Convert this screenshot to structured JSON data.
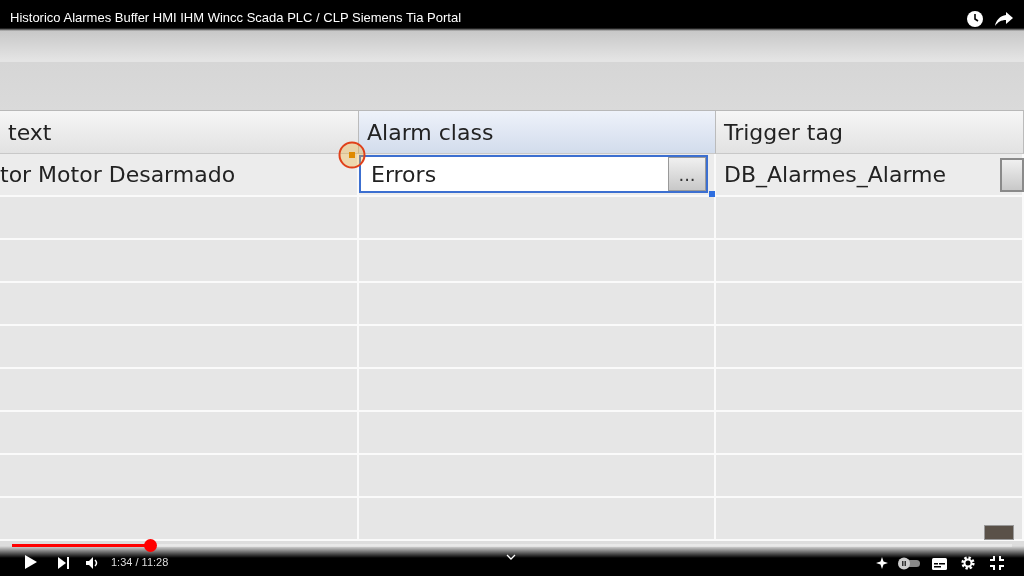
{
  "video_title": "Historico Alarmes Buffer HMI IHM Wincc Scada PLC / CLP Siemens Tia Portal",
  "table": {
    "columns": [
      {
        "label": "text",
        "highlighted": false
      },
      {
        "label": "Alarm class",
        "highlighted": true
      },
      {
        "label": "Trigger tag",
        "highlighted": false
      }
    ],
    "rows": [
      {
        "cells": [
          {
            "kind": "text",
            "text": "tor Motor Desarmado",
            "selected": false
          },
          {
            "kind": "field",
            "text": "Errors",
            "button_label": "...",
            "selected": true
          },
          {
            "kind": "field",
            "text": "DB_Alarmes_Alarme",
            "selected": false
          }
        ]
      }
    ]
  },
  "player": {
    "progress": {
      "level": 0.138
    },
    "time": "1:34 / 11:28"
  }
}
